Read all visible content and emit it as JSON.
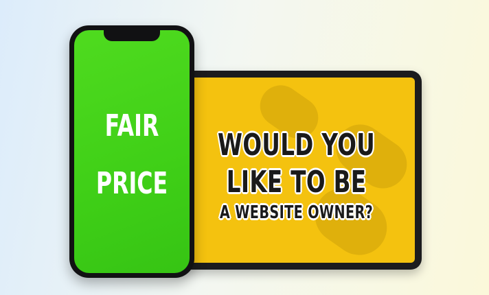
{
  "phone": {
    "screen_color": "#3fcf17",
    "lines": [
      "FAIR",
      "PRICE"
    ]
  },
  "tablet": {
    "screen_color": "#f4c20f",
    "lines": [
      "WOULD YOU",
      "LIKE TO BE",
      "A WEBSITE OWNER?"
    ]
  }
}
